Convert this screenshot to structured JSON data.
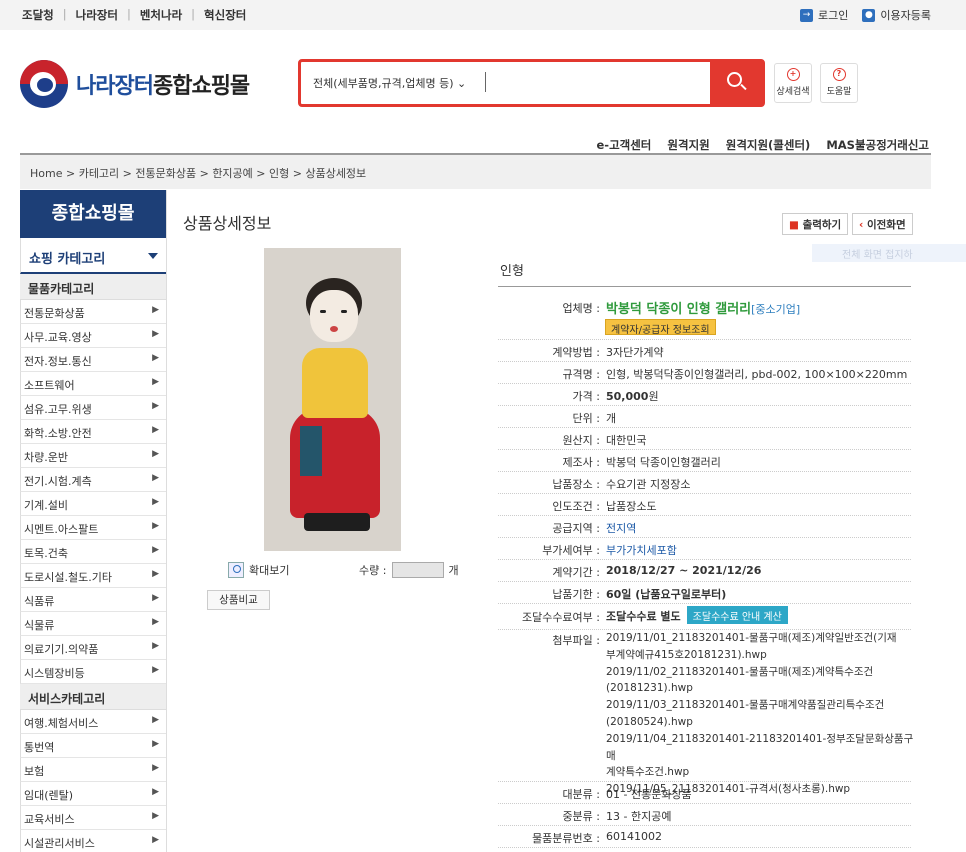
{
  "topbar": {
    "links": [
      "조달청",
      "나라장터",
      "벤처나라",
      "혁신장터"
    ],
    "login": "로그인",
    "register": "이용자등록"
  },
  "logo": {
    "blue": "나라장터",
    "black": "종합쇼핑몰"
  },
  "search": {
    "scope": "전체(세부품명,규격,업체명 등)"
  },
  "header_buttons": {
    "detail_search": "상세검색",
    "help": "도움말"
  },
  "nav_menu": [
    "e-고객센터",
    "원격지원",
    "원격지원(콜센터)",
    "MAS불공정거래신고"
  ],
  "breadcrumb": "Home > 카테고리 > 전통문화상품 > 한지공예 > 인형 > 상품상세정보",
  "sidebar": {
    "title": "종합쇼핑몰",
    "category_toggle": "쇼핑 카테고리",
    "goods_section": "물품카테고리",
    "goods": [
      "전통문화상품",
      "사무.교육.영상",
      "전자.정보.통신",
      "소프트웨어",
      "섬유.고무.위생",
      "화학.소방.안전",
      "차량.운반",
      "전기.시험.계측",
      "기계.설비",
      "시멘트.아스팔트",
      "토목.건축",
      "도로시설.철도.기타",
      "식품류",
      "식물류",
      "의료기기.의약품",
      "시스템장비등"
    ],
    "service_section": "서비스카테고리",
    "services": [
      "여행.체험서비스",
      "통번역",
      "보험",
      "임대(렌탈)",
      "교육서비스",
      "시설관리서비스"
    ]
  },
  "page": {
    "title": "상품상세정보",
    "print": "출력하기",
    "back": "이전화면",
    "faded_text": "전체 화면 접지하",
    "zoom": "확대보기",
    "qty_label": "수량 :",
    "qty_unit": "개",
    "compare": "상품비교",
    "category_name": "인형"
  },
  "details": {
    "vendor_label": "업체명 :",
    "vendor": "박봉덕 닥종이 인형 갤러리",
    "vendor_tag": "[중소기업]",
    "vendor_btn": "계약자/공급자 정보조회",
    "contract_method_label": "계약방법 :",
    "contract_method": "3자단가계약",
    "spec_label": "규격명 :",
    "spec": "인형, 박봉덕닥종이인형갤러리, pbd-002, 100×100×220mm",
    "price_label": "가격 :",
    "price": "50,000",
    "price_unit": "원",
    "unit_label": "단위 :",
    "unit": "개",
    "origin_label": "원산지 :",
    "origin": "대한민국",
    "maker_label": "제조사 :",
    "maker": "박봉덕 닥종이인형갤러리",
    "delivery_place_label": "납품장소 :",
    "delivery_place": "수요기관 지정장소",
    "delivery_cond_label": "인도조건 :",
    "delivery_cond": "납품장소도",
    "supply_area_label": "공급지역 :",
    "supply_area": "전지역",
    "vat_label": "부가세여부 :",
    "vat": "부가가치세포함",
    "period_label": "계약기간 :",
    "period": "2018/12/27 ~ 2021/12/26",
    "deadline_label": "납품기한 :",
    "deadline": "60일 (납품요구일로부터)",
    "fee_label": "조달수수료여부 :",
    "fee": "조달수수료 별도",
    "fee_btn": "조달수수료 안내 계산",
    "files_label": "첨부파일 :",
    "files": [
      "2019/11/01_21183201401-물품구매(제조)계약일반조건(기재",
      "부계약예규415호20181231).hwp",
      "2019/11/02_21183201401-물품구매(제조)계약특수조건",
      "(20181231).hwp",
      "2019/11/03_21183201401-물품구매계약품질관리특수조건",
      "(20180524).hwp",
      "2019/11/04_21183201401-21183201401-정부조달문화상품구매",
      "계약특수조건.hwp",
      "2019/11/05_21183201401-규격서(청사초롱).hwp"
    ],
    "major_label": "대분류 :",
    "major": "01 - 전통문화상품",
    "middle_label": "중분류 :",
    "middle": "13 - 한지공예",
    "class_no_label": "물품분류번호 :",
    "class_no": "60141002"
  }
}
